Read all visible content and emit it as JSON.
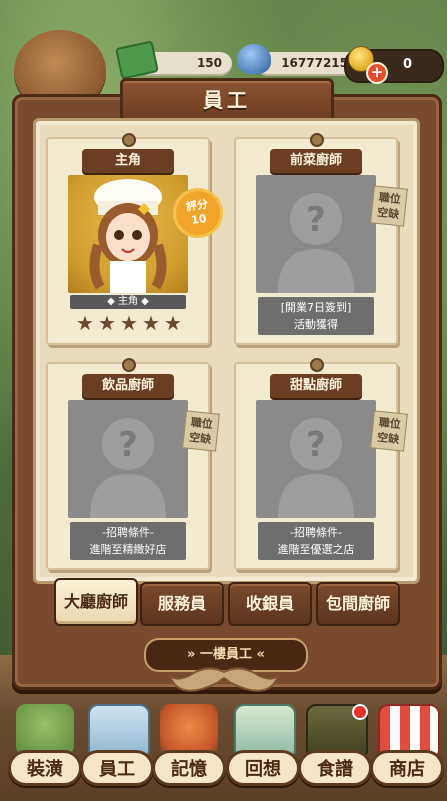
{
  "header": {
    "cash_value": "150",
    "gems_value": "16777215",
    "gold_value": "0"
  },
  "panel": {
    "title": "員工"
  },
  "cards": [
    {
      "title": "主角",
      "name": "主角",
      "rating_label": "評分",
      "rating_value": "10",
      "stars": 5
    },
    {
      "title": "前菜廚師",
      "tag": "職位\n空缺",
      "caption_line1": "[開業7日簽到]",
      "caption_line2": "活動獲得"
    },
    {
      "title": "飲品廚師",
      "tag": "職位\n空缺",
      "caption_line1": "-招聘條件-",
      "caption_line2": "進階至精緻好店"
    },
    {
      "title": "甜點廚師",
      "tag": "職位\n空缺",
      "caption_line1": "-招聘條件-",
      "caption_line2": "進階至優選之店"
    }
  ],
  "tabs": [
    {
      "label": "大廳廚師",
      "active": true
    },
    {
      "label": "服務員"
    },
    {
      "label": "收銀員"
    },
    {
      "label": "包間廚師"
    }
  ],
  "floor_selector": {
    "label": "一樓員工"
  },
  "nav": [
    {
      "label": "裝潢",
      "icon": "renovation-icon"
    },
    {
      "label": "員工",
      "icon": "staff-card-icon"
    },
    {
      "label": "記憶",
      "icon": "memory-fish-icon"
    },
    {
      "label": "回想",
      "icon": "recall-scroll-icon"
    },
    {
      "label": "食譜",
      "icon": "recipe-book-icon",
      "badge": true
    },
    {
      "label": "商店",
      "icon": "shop-icon"
    }
  ]
}
